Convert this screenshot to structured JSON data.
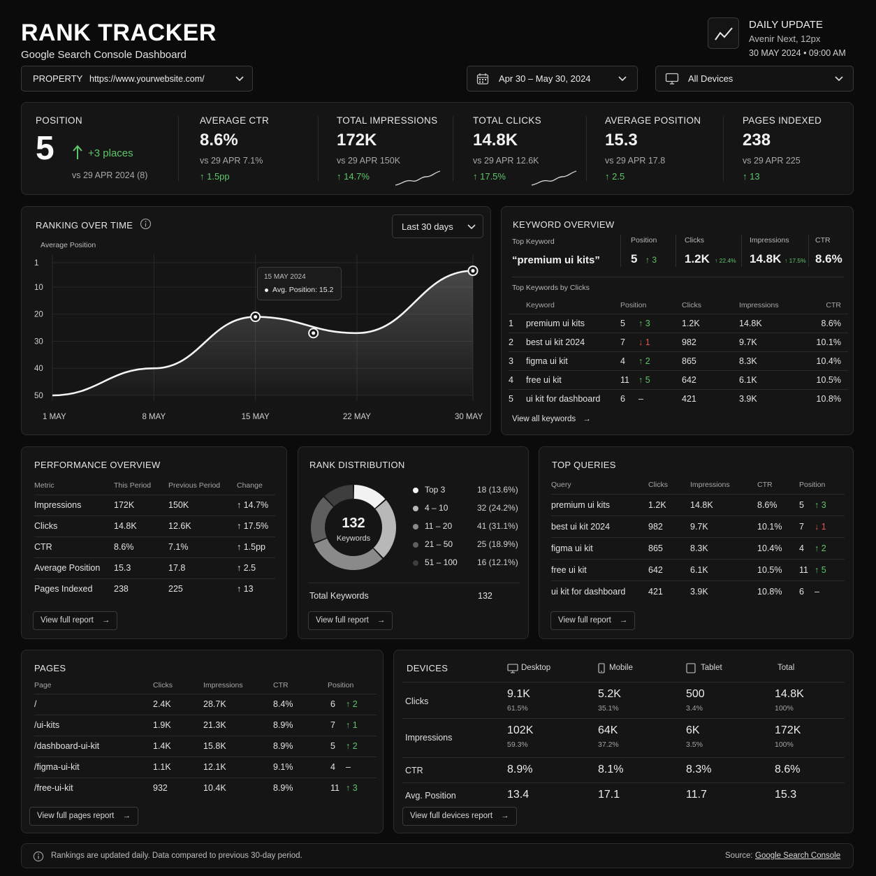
{
  "header": {
    "title": "RANK TRACKER",
    "subtitle": "Google Search Console Dashboard",
    "update_title": "DAILY UPDATE",
    "update_font": "Avenir Next, 12px",
    "update_date": "30 MAY 2024 • 09:00 AM"
  },
  "property": {
    "label": "PROPERTY",
    "value": "https://www.yourwebsite.com/"
  },
  "date_range": {
    "value": "Apr 30 – May 30, 2024"
  },
  "device_filter": {
    "value": "All Devices"
  },
  "kpis": [
    {
      "label": "POSITION",
      "value": "5",
      "delta": "+3 places",
      "compare": "vs 29 APR 2024 (8)"
    },
    {
      "label": "AVERAGE CTR",
      "value": "8.6%",
      "compare": "vs 29 APR 7.1%",
      "change": "↑ 1.5pp"
    },
    {
      "label": "TOTAL IMPRESSIONS",
      "value": "172K",
      "compare": "vs 29 APR 150K",
      "change": "↑ 14.7%"
    },
    {
      "label": "TOTAL CLICKS",
      "value": "14.8K",
      "compare": "vs 29 APR 12.6K",
      "change": "↑ 17.5%"
    },
    {
      "label": "AVERAGE POSITION",
      "value": "15.3",
      "compare": "vs 29 APR 17.8",
      "change": "↑ 2.5"
    },
    {
      "label": "PAGES INDEXED",
      "value": "238",
      "compare": "vs 29 APR 225",
      "change": "↑ 13"
    }
  ],
  "ranking": {
    "title": "RANKING OVER TIME",
    "range": "Last 30 days",
    "tooltip_date": "15 MAY 2024",
    "tooltip_text": "Avg. Position: 15.2"
  },
  "chart_data": {
    "type": "area",
    "ylabel": "Average Position",
    "y_ticks": [
      "1",
      "10",
      "20",
      "30",
      "40",
      "50"
    ],
    "ylim": [
      50,
      1
    ],
    "inverted_y": true,
    "x_ticks": [
      "1 MAY",
      "8 MAY",
      "15 MAY",
      "22 MAY",
      "30 MAY"
    ],
    "points": [
      {
        "x": "1 MAY",
        "y": 50
      },
      {
        "x": "8 MAY",
        "y": 40
      },
      {
        "x": "15 MAY",
        "y": 21
      },
      {
        "x": "22 MAY",
        "y": 27
      },
      {
        "x": "30 MAY",
        "y": 4
      }
    ],
    "markers": [
      {
        "x": "15 MAY",
        "y": 21
      },
      {
        "x": "19 MAY",
        "y": 27
      },
      {
        "x": "30 MAY",
        "y": 4
      }
    ],
    "grid": true
  },
  "keyword_overview": {
    "title": "KEYWORD OVERVIEW",
    "top_label": "Top Keyword",
    "top_keyword": "“premium ui kits”",
    "stats": [
      {
        "label": "Position",
        "value": "5",
        "delta": "↑ 3"
      },
      {
        "label": "Clicks",
        "value": "1.2K",
        "delta": "↑ 22.4%"
      },
      {
        "label": "Impressions",
        "value": "14.8K",
        "delta": "↑ 17.5%"
      },
      {
        "label": "CTR",
        "value": "8.6%",
        "delta": ""
      }
    ],
    "list_label": "Top Keywords by Clicks",
    "headers": [
      "Keyword",
      "Position",
      "Clicks",
      "Impressions",
      "CTR"
    ],
    "rows": [
      {
        "n": "1",
        "kw": "premium ui kits",
        "pos": "5",
        "ch": "↑ 3",
        "dir": "up",
        "clicks": "1.2K",
        "imp": "14.8K",
        "ctr": "8.6%"
      },
      {
        "n": "2",
        "kw": "best ui kit 2024",
        "pos": "7",
        "ch": "↓ 1",
        "dir": "down",
        "clicks": "982",
        "imp": "9.7K",
        "ctr": "10.1%"
      },
      {
        "n": "3",
        "kw": "figma ui kit",
        "pos": "4",
        "ch": "↑ 2",
        "dir": "up",
        "clicks": "865",
        "imp": "8.3K",
        "ctr": "10.4%"
      },
      {
        "n": "4",
        "kw": "free ui kit",
        "pos": "11",
        "ch": "↑ 5",
        "dir": "up",
        "clicks": "642",
        "imp": "6.1K",
        "ctr": "10.5%"
      },
      {
        "n": "5",
        "kw": "ui kit for dashboard",
        "pos": "6",
        "ch": "–",
        "dir": "flat",
        "clicks": "421",
        "imp": "3.9K",
        "ctr": "10.8%"
      }
    ],
    "link": "View all keywords"
  },
  "performance": {
    "title": "PERFORMANCE OVERVIEW",
    "headers": [
      "Metric",
      "This Period",
      "Previous Period",
      "Change"
    ],
    "rows": [
      {
        "m": "Impressions",
        "t": "172K",
        "p": "150K",
        "c": "↑ 14.7%"
      },
      {
        "m": "Clicks",
        "t": "14.8K",
        "p": "12.6K",
        "c": "↑ 17.5%"
      },
      {
        "m": "CTR",
        "t": "8.6%",
        "p": "7.1%",
        "c": "↑ 1.5pp"
      },
      {
        "m": "Average Position",
        "t": "15.3",
        "p": "17.8",
        "c": "↑ 2.5"
      },
      {
        "m": "Pages Indexed",
        "t": "238",
        "p": "225",
        "c": "↑ 13"
      }
    ],
    "link": "View full report"
  },
  "distribution": {
    "title": "RANK DISTRIBUTION",
    "total": "132",
    "total_label": "Keywords",
    "segments": [
      {
        "label": "Top 3",
        "value": "18 (13.6%)",
        "count": 18,
        "color": "#f2f2f2"
      },
      {
        "label": "4 – 10",
        "value": "32 (24.2%)",
        "count": 32,
        "color": "#b8b8b8"
      },
      {
        "label": "11 – 20",
        "value": "41 (31.1%)",
        "count": 41,
        "color": "#8a8a8a"
      },
      {
        "label": "21 – 50",
        "value": "25 (18.9%)",
        "count": 25,
        "color": "#5e5e5e"
      },
      {
        "label": "51 – 100",
        "value": "16 (12.1%)",
        "count": 16,
        "color": "#3e3e3e"
      }
    ],
    "footer_label": "Total Keywords",
    "footer_value": "132",
    "link": "View full report"
  },
  "top_queries": {
    "title": "TOP QUERIES",
    "headers": [
      "Query",
      "Clicks",
      "Impressions",
      "CTR",
      "Position"
    ],
    "rows": [
      {
        "q": "premium ui kits",
        "c": "1.2K",
        "i": "14.8K",
        "ctr": "8.6%",
        "p": "5",
        "ch": "↑ 3",
        "dir": "up"
      },
      {
        "q": "best ui kit 2024",
        "c": "982",
        "i": "9.7K",
        "ctr": "10.1%",
        "p": "7",
        "ch": "↓ 1",
        "dir": "down"
      },
      {
        "q": "figma ui kit",
        "c": "865",
        "i": "8.3K",
        "ctr": "10.4%",
        "p": "4",
        "ch": "↑ 2",
        "dir": "up"
      },
      {
        "q": "free ui kit",
        "c": "642",
        "i": "6.1K",
        "ctr": "10.5%",
        "p": "11",
        "ch": "↑ 5",
        "dir": "up"
      },
      {
        "q": "ui kit for dashboard",
        "c": "421",
        "i": "3.9K",
        "ctr": "10.8%",
        "p": "6",
        "ch": "–",
        "dir": "flat"
      }
    ],
    "link": "View full report"
  },
  "pages": {
    "title": "PAGES",
    "headers": [
      "Page",
      "Clicks",
      "Impressions",
      "CTR",
      "Position"
    ],
    "rows": [
      {
        "pg": "/",
        "c": "2.4K",
        "i": "28.7K",
        "ctr": "8.4%",
        "p": "6",
        "ch": "↑ 2",
        "dir": "up"
      },
      {
        "pg": "/ui-kits",
        "c": "1.9K",
        "i": "21.3K",
        "ctr": "8.9%",
        "p": "7",
        "ch": "↑ 1",
        "dir": "up"
      },
      {
        "pg": "/dashboard-ui-kit",
        "c": "1.4K",
        "i": "15.8K",
        "ctr": "8.9%",
        "p": "5",
        "ch": "↑ 2",
        "dir": "up"
      },
      {
        "pg": "/figma-ui-kit",
        "c": "1.1K",
        "i": "12.1K",
        "ctr": "9.1%",
        "p": "4",
        "ch": "–",
        "dir": "flat"
      },
      {
        "pg": "/free-ui-kit",
        "c": "932",
        "i": "10.4K",
        "ctr": "8.9%",
        "p": "11",
        "ch": "↑ 3",
        "dir": "up"
      }
    ],
    "link": "View full pages report"
  },
  "devices": {
    "title": "DEVICES",
    "cols": [
      "Desktop",
      "Mobile",
      "Tablet",
      "Total"
    ],
    "rows": [
      {
        "label": "Clicks",
        "vals": [
          {
            "v": "9.1K",
            "p": "61.5%"
          },
          {
            "v": "5.2K",
            "p": "35.1%"
          },
          {
            "v": "500",
            "p": "3.4%"
          },
          {
            "v": "14.8K",
            "p": "100%"
          }
        ]
      },
      {
        "label": "Impressions",
        "vals": [
          {
            "v": "102K",
            "p": "59.3%"
          },
          {
            "v": "64K",
            "p": "37.2%"
          },
          {
            "v": "6K",
            "p": "3.5%"
          },
          {
            "v": "172K",
            "p": "100%"
          }
        ]
      },
      {
        "label": "CTR",
        "vals": [
          {
            "v": "8.9%",
            "p": ""
          },
          {
            "v": "8.1%",
            "p": ""
          },
          {
            "v": "8.3%",
            "p": ""
          },
          {
            "v": "8.6%",
            "p": ""
          }
        ]
      },
      {
        "label": "Avg. Position",
        "vals": [
          {
            "v": "13.4",
            "p": ""
          },
          {
            "v": "17.1",
            "p": ""
          },
          {
            "v": "11.7",
            "p": ""
          },
          {
            "v": "15.3",
            "p": ""
          }
        ]
      }
    ],
    "link": "View full devices report"
  },
  "footer": {
    "note": "Rankings are updated daily. Data compared to previous 30-day period.",
    "source_label": "Source:",
    "source_link": "Google Search Console"
  }
}
